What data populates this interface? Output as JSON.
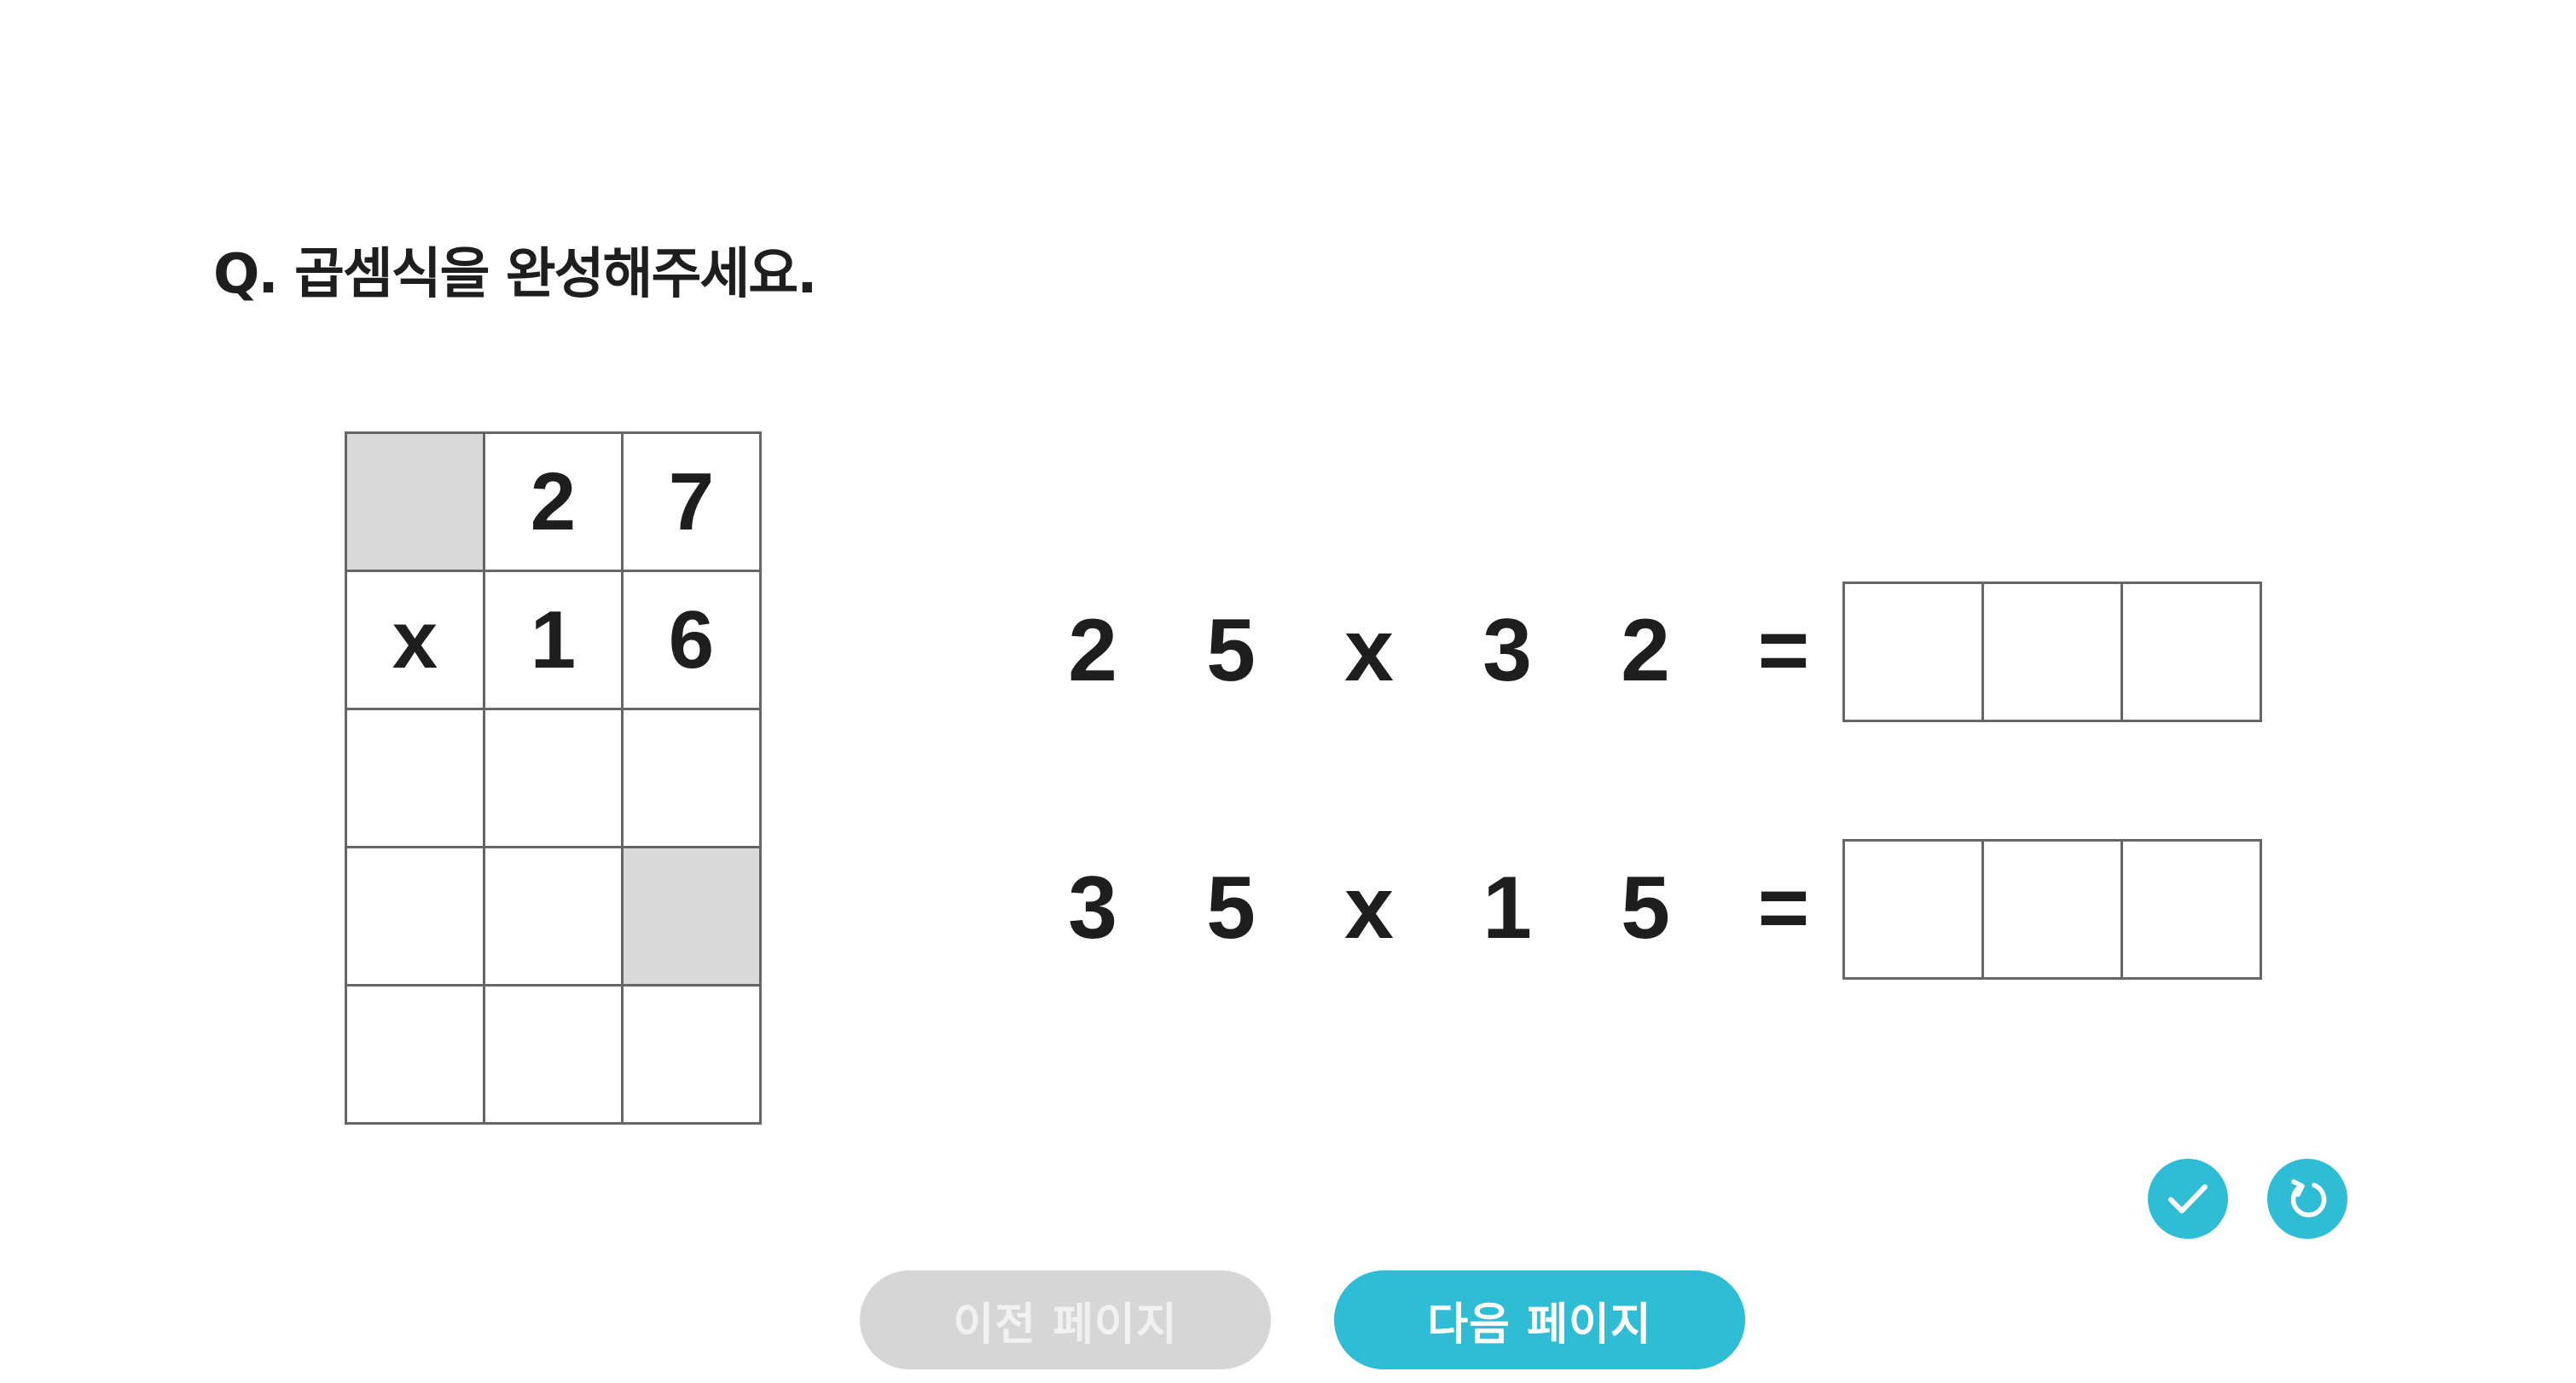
{
  "question": "Q. 곱셈식을 완성해주세요.",
  "grid": {
    "rows": [
      [
        "",
        "2",
        "7"
      ],
      [
        "x",
        "1",
        "6"
      ],
      [
        "",
        "",
        ""
      ],
      [
        "",
        "",
        ""
      ],
      [
        "",
        "",
        ""
      ]
    ],
    "shaded_cells": [
      [
        0,
        0
      ],
      [
        3,
        2
      ]
    ]
  },
  "equations": [
    {
      "a1": "2",
      "a2": "5",
      "op": "x",
      "b1": "3",
      "b2": "2",
      "eq": "=",
      "answer": [
        "",
        "",
        ""
      ]
    },
    {
      "a1": "3",
      "a2": "5",
      "op": "x",
      "b1": "1",
      "b2": "5",
      "eq": "=",
      "answer": [
        "",
        "",
        ""
      ]
    }
  ],
  "buttons": {
    "check_icon": "check-icon",
    "reset_icon": "reset-icon",
    "prev_label": "이전 페이지",
    "next_label": "다음 페이지"
  },
  "colors": {
    "accent": "#2fbcd5",
    "disabled": "#d6d6d6",
    "shaded": "#d9d9d9",
    "text": "#1e1e1e"
  }
}
